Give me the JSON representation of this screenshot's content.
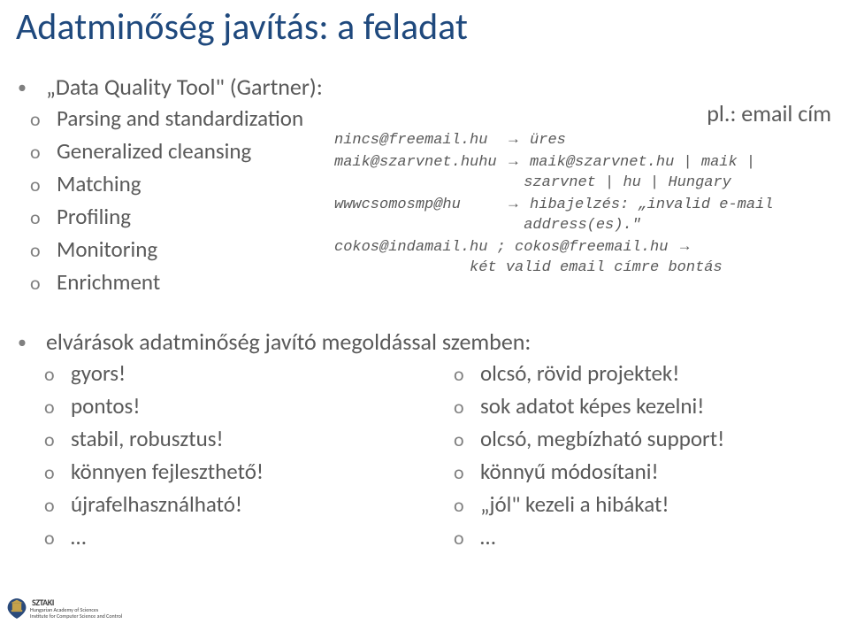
{
  "title": "Adatminőség javítás: a feladat",
  "section1": {
    "lead": "„Data Quality Tool\" (Gartner):",
    "items": [
      "Parsing and standardization",
      "Generalized cleansing",
      "Matching",
      "Profiling",
      "Monitoring",
      "Enrichment"
    ]
  },
  "example": {
    "label": "pl.: email cím",
    "l1a": "nincs@freemail.hu  ",
    "l1b": "→",
    "l1c": " üres",
    "l2a": "maik@szarvnet.huhu ",
    "l2b": "→",
    "l2c": " maik@szarvnet.hu | maik |",
    "l3": "                     szarvnet | hu | Hungary",
    "l4a": "wwwcsomosmp@hu     ",
    "l4b": "→",
    "l4c": " hibajelzés: „invalid e-mail",
    "l5": "                     address(es).\"",
    "l6a": "cokos@indamail.hu ; cokos@freemail.hu ",
    "l6b": "→",
    "l7": "               két valid email címre bontás"
  },
  "section2": {
    "lead": "elvárások adatminőség javító megoldással szemben:",
    "left": [
      "gyors!",
      "pontos!",
      "stabil, robusztus!",
      "könnyen fejleszthető!",
      "újrafelhasználható!",
      "…"
    ],
    "right": [
      "olcsó, rövid projektek!",
      "sok adatot képes kezelni!",
      "olcsó, megbízható support!",
      "könnyű módosítani!",
      "„jól\" kezeli a hibákat!",
      "…"
    ]
  },
  "footer": {
    "acronym": "SZTAKI",
    "line1": "Hungarian Academy of Sciences",
    "line2": "Institute for Computer Science and Control"
  }
}
